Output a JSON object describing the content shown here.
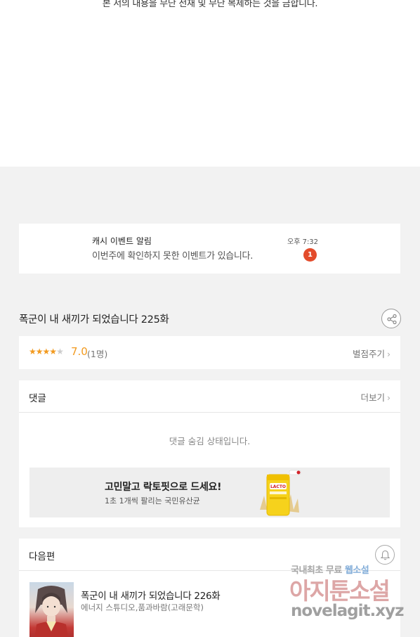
{
  "copyright": "본 서의 내용을 무단 전재 및 무단 복제하는 것을 금합니다.",
  "notification": {
    "title": "캐시 이벤트 알림",
    "body": "이번주에 확인하지 못한 이벤트가 있습니다.",
    "time": "오후 7:32",
    "badge": "1"
  },
  "episode": {
    "title": "폭군이 내 새끼가 되었습니다 225화"
  },
  "rating": {
    "stars_value": 3.5,
    "stars_max": 5,
    "score": "7.0",
    "count": "(1명)",
    "action": "별점주기"
  },
  "comments": {
    "title": "댓글",
    "more": "더보기",
    "hidden_message": "댓글 숨김 상태입니다."
  },
  "ad": {
    "title": "고민말고 락토핏으로 드세요!",
    "subtitle": "1초 1개씩 팔리는 국민유산균",
    "product_label": "LACTO"
  },
  "next": {
    "section_title": "다음편",
    "title": "폭군이 내 새끼가 되었습니다 226화",
    "author": "에너지 스튜디오,품과바람(고래문학)"
  },
  "watermark": {
    "line1_a": "국내최초 무료 ",
    "line1_b": "웹소설",
    "line2": "아지툰소설",
    "line3": "novelagit.xyz"
  },
  "colors": {
    "accent": "#f29a1f",
    "badge": "#e34b2b",
    "background": "#f2f2f2"
  },
  "icons": {
    "share": "share-icon",
    "bell": "bell-icon",
    "chevron": "chevron-right-icon",
    "star": "star-icon"
  }
}
